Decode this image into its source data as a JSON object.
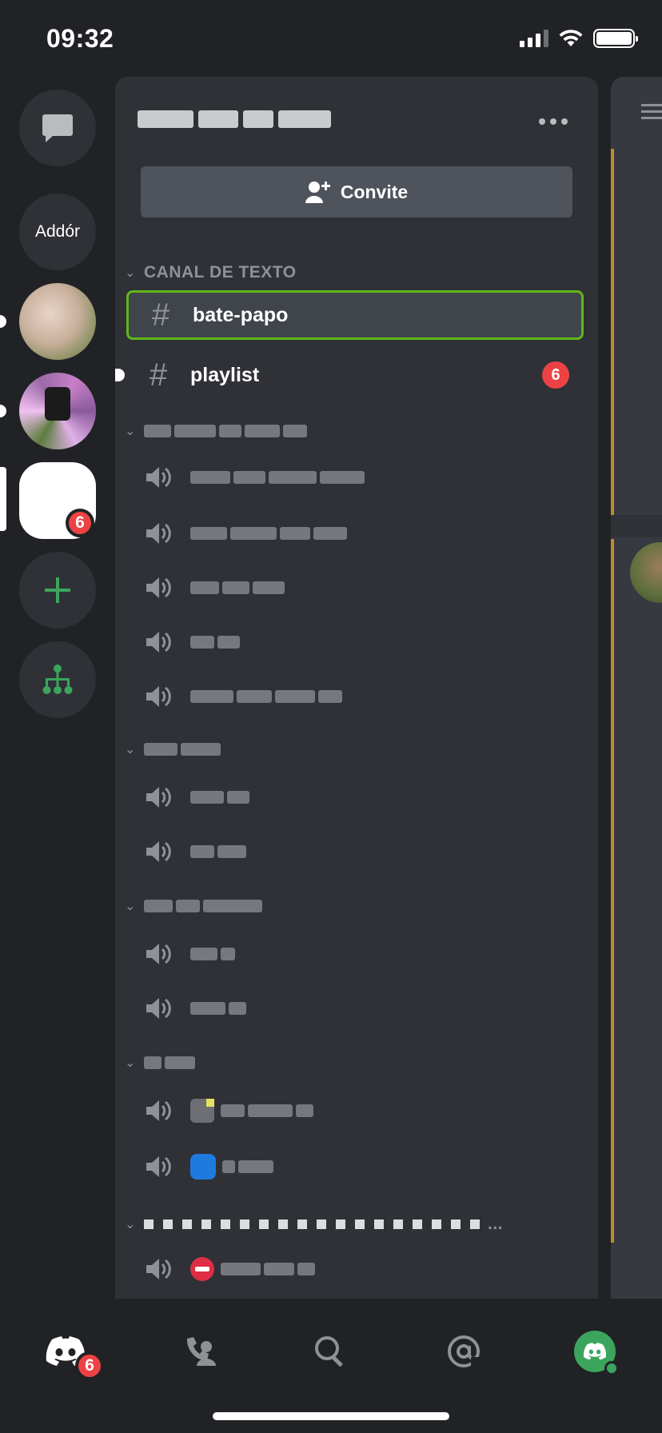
{
  "status_bar": {
    "time": "09:32"
  },
  "rail": {
    "server_label": "Addór",
    "notification_count": "6"
  },
  "panel": {
    "invite_label": "Convite",
    "text_category": "CANAL DE TEXTO",
    "channels": [
      {
        "name": "bate-papo",
        "active": true
      },
      {
        "name": "playlist",
        "badge": "6"
      }
    ],
    "last_category_ellipsis": "..."
  },
  "tabbar": {
    "home_badge": "6"
  },
  "colors": {
    "background": "#202225",
    "panel": "#2f3136",
    "active_channel_border": "#5fb61a",
    "badge": "#ed4245",
    "accent_green": "#3ba55d"
  },
  "icons": [
    "chat-bubble-icon",
    "plus-icon",
    "server-discovery-icon",
    "hash-icon",
    "speaker-icon",
    "add-friend-icon",
    "more-dots-icon",
    "discord-home-icon",
    "friends-icon",
    "search-icon",
    "mention-icon"
  ]
}
